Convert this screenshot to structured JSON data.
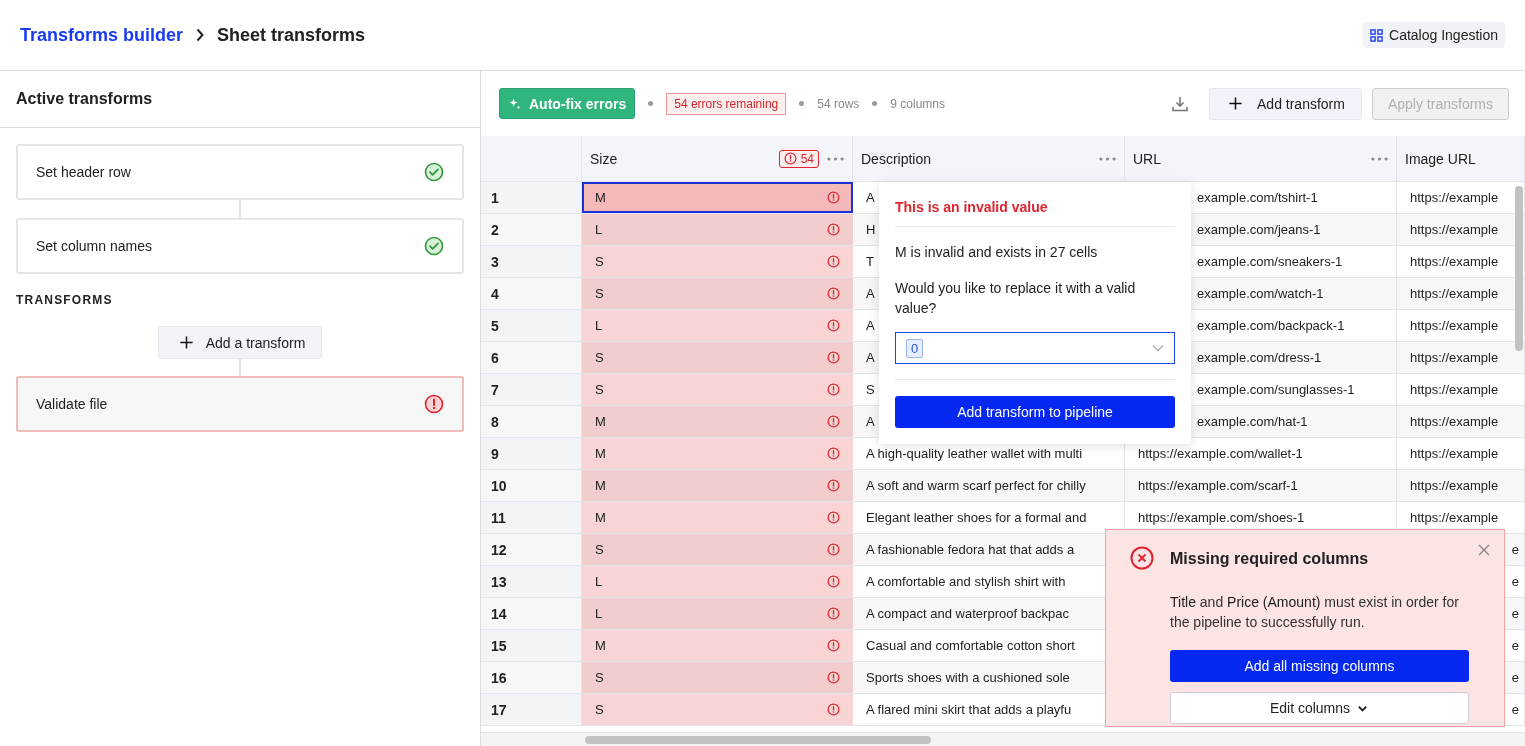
{
  "header": {
    "breadcrumb": [
      {
        "label": "Transforms builder",
        "kind": "link"
      },
      {
        "label": "Sheet transforms",
        "kind": "current"
      }
    ],
    "workspace": "Catalog Ingestion"
  },
  "sidebar": {
    "title": "Active transforms",
    "steps": [
      {
        "label": "Set header row",
        "valid": true
      },
      {
        "label": "Set column names",
        "valid": true
      }
    ],
    "section": "TRANSFORMS",
    "add_button": "Add a transform",
    "transforms": [
      {
        "label": "Validate file",
        "valid": false
      }
    ]
  },
  "toolbar": {
    "autofix": "Auto-fix errors",
    "errors": "54 errors remaining",
    "rows": "54 rows",
    "columns": "9 columns",
    "add": "Add transform",
    "apply": {
      "label": "Apply transforms",
      "disabled": true
    }
  },
  "table": {
    "columns": [
      {
        "label": "Size",
        "error_count": "54",
        "menu": true
      },
      {
        "label": "Description",
        "menu": true
      },
      {
        "label": "URL",
        "menu": true
      },
      {
        "label": "Image URL",
        "menu": false
      }
    ],
    "rows": [
      {
        "number": "1",
        "size": "M",
        "error": true,
        "selected": true,
        "description": "A",
        "url": "example.com/tshirt-1",
        "image_url": "https://example"
      },
      {
        "number": "2",
        "size": "L",
        "error": true,
        "selected": false,
        "description": "H",
        "url": "example.com/jeans-1",
        "image_url": "https://example"
      },
      {
        "number": "3",
        "size": "S",
        "error": true,
        "selected": false,
        "description": "T",
        "url": "example.com/sneakers-1",
        "image_url": "https://example"
      },
      {
        "number": "4",
        "size": "S",
        "error": true,
        "selected": false,
        "description": "A",
        "url": "example.com/watch-1",
        "image_url": "https://example"
      },
      {
        "number": "5",
        "size": "L",
        "error": true,
        "selected": false,
        "description": "A",
        "url": "example.com/backpack-1",
        "image_url": "https://example"
      },
      {
        "number": "6",
        "size": "S",
        "error": true,
        "selected": false,
        "description": "A",
        "url": "example.com/dress-1",
        "image_url": "https://example"
      },
      {
        "number": "7",
        "size": "S",
        "error": true,
        "selected": false,
        "description": "S",
        "url": "example.com/sunglasses-1",
        "image_url": "https://example"
      },
      {
        "number": "8",
        "size": "M",
        "error": true,
        "selected": false,
        "description": "A",
        "url": "example.com/hat-1",
        "image_url": "https://example"
      },
      {
        "number": "9",
        "size": "M",
        "error": true,
        "selected": false,
        "description": "A high-quality leather wallet with multi",
        "url": "https://example.com/wallet-1",
        "image_url": "https://example"
      },
      {
        "number": "10",
        "size": "M",
        "error": true,
        "selected": false,
        "description": "A soft and warm scarf perfect for chilly",
        "url": "https://example.com/scarf-1",
        "image_url": "https://example"
      },
      {
        "number": "11",
        "size": "M",
        "error": true,
        "selected": false,
        "description": "Elegant leather shoes for a formal and",
        "url": "https://example.com/shoes-1",
        "image_url": "https://example"
      },
      {
        "number": "12",
        "size": "S",
        "error": true,
        "selected": false,
        "description": "A fashionable fedora hat that adds a",
        "image_url": "e"
      },
      {
        "number": "13",
        "size": "L",
        "error": true,
        "selected": false,
        "description": "A comfortable and stylish shirt with",
        "image_url": "e"
      },
      {
        "number": "14",
        "size": "L",
        "error": true,
        "selected": false,
        "description": "A compact and waterproof backpac",
        "image_url": "e"
      },
      {
        "number": "15",
        "size": "M",
        "error": true,
        "selected": false,
        "description": "Casual and comfortable cotton short",
        "image_url": "e"
      },
      {
        "number": "16",
        "size": "S",
        "error": true,
        "selected": false,
        "description": "Sports shoes with a cushioned sole",
        "image_url": "e"
      },
      {
        "number": "17",
        "size": "S",
        "error": true,
        "selected": false,
        "description": "A flared mini skirt that adds a playfu",
        "image_url": "e"
      }
    ]
  },
  "popover": {
    "title": "This is an invalid value",
    "message": "M is invalid and exists in 27 cells",
    "question": "Would you like to replace it with a valid value?",
    "select_value": "0",
    "button": "Add transform to pipeline"
  },
  "toast": {
    "title": "Missing required columns",
    "body": "**Title** and **Price (Amount)** must exist in order for the pipeline to successfully run.",
    "primary": "Add all missing columns",
    "secondary": "Edit columns"
  }
}
